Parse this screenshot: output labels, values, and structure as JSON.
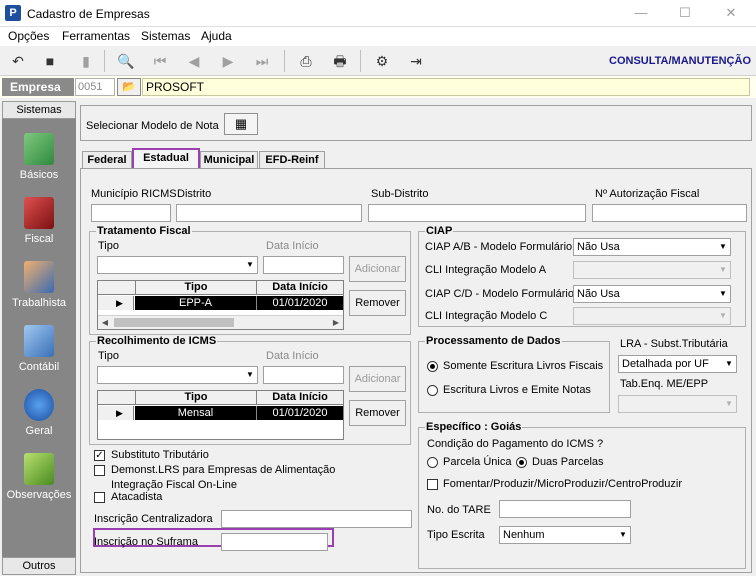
{
  "window": {
    "title": "Cadastro de Empresas",
    "app_icon": "P"
  },
  "menu": [
    "Opções",
    "Ferramentas",
    "Sistemas",
    "Ajuda"
  ],
  "toolbar": {
    "mode_label": "CONSULTA/MANUTENÇÃO"
  },
  "empresa": {
    "label": "Empresa",
    "code": "0051",
    "name": "PROSOFT"
  },
  "sidebar": {
    "header": "Sistemas",
    "footer": "Outros",
    "items": [
      "Básicos",
      "Fiscal",
      "Trabalhista",
      "Contábil",
      "Geral",
      "Observações"
    ]
  },
  "modelo": {
    "label": "Selecionar Modelo de Nota"
  },
  "tabs": [
    "Federal",
    "Estadual",
    "Municipal",
    "EFD-Reinf"
  ],
  "estadual": {
    "municipio_label": "Município RICMS",
    "distrito_label": "Distrito",
    "subdistrito_label": "Sub-Distrito",
    "autorizacao_label": "Nº Autorização Fiscal",
    "tratamento": {
      "title": "Tratamento Fiscal",
      "tipo_label": "Tipo",
      "data_label": "Data Início",
      "adicionar": "Adicionar",
      "remover": "Remover",
      "grid_headers": [
        "Tipo",
        "Data Início"
      ],
      "row": [
        "EPP-A",
        "01/01/2020"
      ]
    },
    "recolhimento": {
      "title": "Recolhimento de ICMS",
      "tipo_label": "Tipo",
      "data_label": "Data Início",
      "adicionar": "Adicionar",
      "remover": "Remover",
      "grid_headers": [
        "Tipo",
        "Data Início"
      ],
      "row": [
        "Mensal",
        "01/01/2020"
      ]
    },
    "ciap": {
      "title": "CIAP",
      "ab_label": "CIAP  A/B - Modelo Formulário",
      "ab_value": "Não Usa",
      "cli_a_label": "CLI Integração Modelo A",
      "cd_label": "CIAP C/D - Modelo Formulário",
      "cd_value": "Não Usa",
      "cli_c_label": "CLI Integração Modelo C"
    },
    "processamento": {
      "title": "Processamento de Dados",
      "opt1": "Somente Escritura Livros Fiscais",
      "opt2": "Escritura Livros e Emite Notas"
    },
    "lra": {
      "label": "LRA - Subst.Tributária",
      "value": "Detalhada por UF",
      "tab_label": "Tab.Enq. ME/EPP"
    },
    "checks": {
      "substituto": "Substituto Tributário",
      "demonst": "Demonst.LRS para Empresas de Alimentação",
      "integracao": "Integração Fiscal On-Line",
      "atacadista": "Atacadista"
    },
    "inscricao_centralizadora": "Inscrição Centralizadora",
    "inscricao_suframa": "Inscrição no Suframa",
    "goias": {
      "title": "Específico : Goiás",
      "condicao": "Condição do Pagamento do ICMS ?",
      "parcela_unica": "Parcela Única",
      "duas_parcelas": "Duas Parcelas",
      "fomentar": "Fomentar/Produzir/MicroProduzir/CentroProduzir",
      "tare_label": "No. do TARE",
      "tipo_escrita_label": "Tipo Escrita",
      "tipo_escrita_value": "Nenhum"
    }
  }
}
